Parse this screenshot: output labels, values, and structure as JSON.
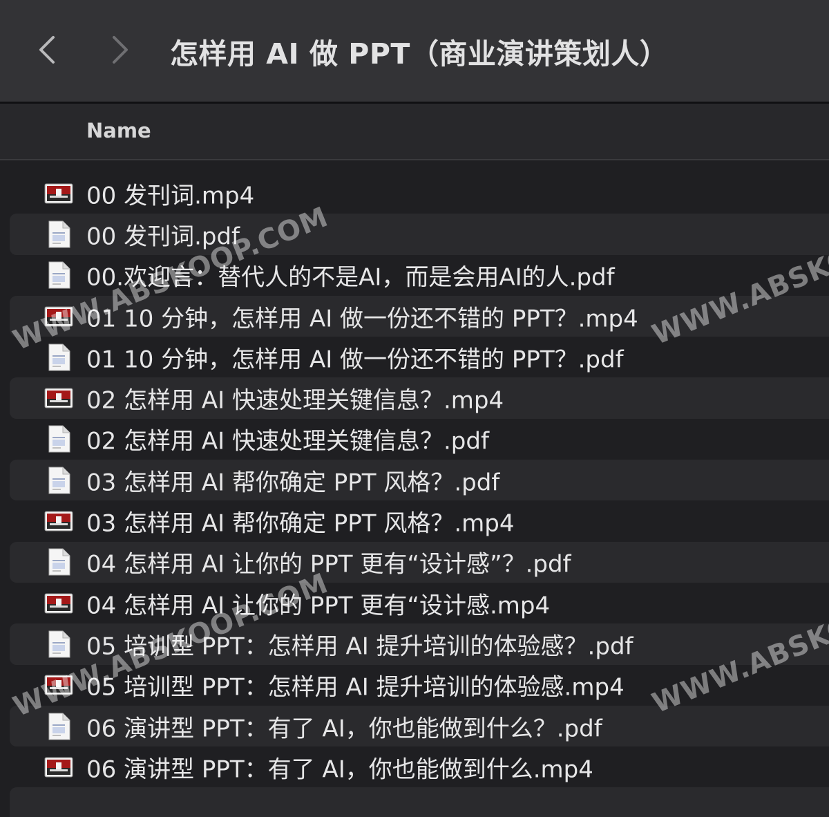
{
  "window": {
    "title": "怎样用 AI 做 PPT（商业演讲策划人）"
  },
  "toolbar": {
    "back_icon": "chevron-left-icon",
    "forward_icon": "chevron-right-icon"
  },
  "columns": {
    "name": "Name"
  },
  "files": [
    {
      "name": "00 发刊词.mp4",
      "type": "video"
    },
    {
      "name": "00 发刊词.pdf",
      "type": "pdf"
    },
    {
      "name": "00.欢迎言：替代人的不是AI，而是会用AI的人.pdf",
      "type": "pdf"
    },
    {
      "name": "01 10 分钟，怎样用 AI 做一份还不错的 PPT？.mp4",
      "type": "video"
    },
    {
      "name": "01 10 分钟，怎样用 AI 做一份还不错的 PPT？.pdf",
      "type": "pdf"
    },
    {
      "name": "02 怎样用 AI 快速处理关键信息？.mp4",
      "type": "video"
    },
    {
      "name": "02 怎样用 AI 快速处理关键信息？.pdf",
      "type": "pdf"
    },
    {
      "name": "03 怎样用 AI 帮你确定 PPT 风格？.pdf",
      "type": "pdf"
    },
    {
      "name": "03 怎样用 AI 帮你确定 PPT 风格？.mp4",
      "type": "video"
    },
    {
      "name": "04 怎样用 AI 让你的 PPT 更有“设计感”？.pdf",
      "type": "pdf"
    },
    {
      "name": "04 怎样用 AI 让你的 PPT 更有“设计感.mp4",
      "type": "video"
    },
    {
      "name": "05 培训型 PPT：怎样用 AI 提升培训的体验感？.pdf",
      "type": "pdf"
    },
    {
      "name": "05 培训型 PPT：怎样用 AI 提升培训的体验感.mp4",
      "type": "video"
    },
    {
      "name": "06 演讲型 PPT：有了 AI，你也能做到什么？.pdf",
      "type": "pdf"
    },
    {
      "name": "06 演讲型 PPT：有了 AI，你也能做到什么.mp4",
      "type": "video"
    }
  ],
  "watermarks": {
    "w1": "WWW.ABSKOOP.COM",
    "w2": "WWW.ABSKO",
    "w3": "WWW.ABSKOOP.COM",
    "w4": "WWW.ABSKO",
    "w5": "WW",
    "w6": "WW"
  },
  "colors": {
    "titlebar": "#333336",
    "background": "#1f1f22",
    "row_alt": "#2a2a2d",
    "text": "#e6e6e7"
  }
}
